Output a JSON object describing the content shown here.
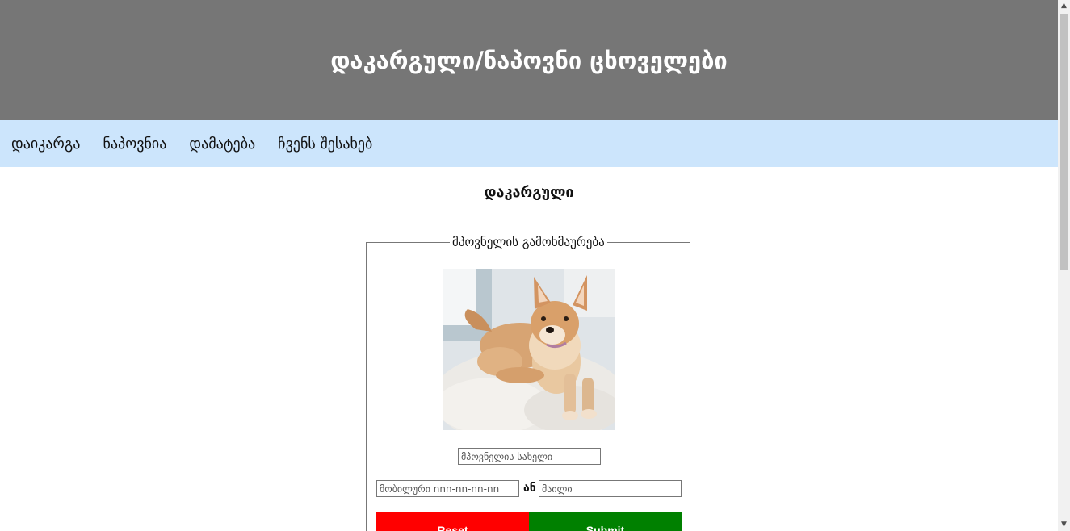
{
  "header": {
    "title": "დაკარგული/ნაპოვნი ცხოველები"
  },
  "nav": {
    "items": [
      {
        "label": "დაიკარგა"
      },
      {
        "label": "ნაპოვნია"
      },
      {
        "label": "დამატება"
      },
      {
        "label": "ჩვენს შესახებ"
      }
    ]
  },
  "main": {
    "section_title": "დაკარგული",
    "form": {
      "legend": "მპოვნელის გამოხმაურება",
      "finder_name_placeholder": "მპოვნელის სახელი",
      "phone_placeholder": "მობილური nnn-nn-nn-nn",
      "or_label": "ან",
      "mail_placeholder": "მაილი",
      "reset_label": "Reset",
      "submit_label": "Submit"
    }
  },
  "colors": {
    "header_bg": "#767676",
    "nav_bg": "#cce5fc",
    "reset_bg": "#ff0000",
    "submit_bg": "#008000"
  },
  "icons": {
    "scroll_up": "chevron-up-icon",
    "scroll_down": "chevron-down-icon"
  }
}
